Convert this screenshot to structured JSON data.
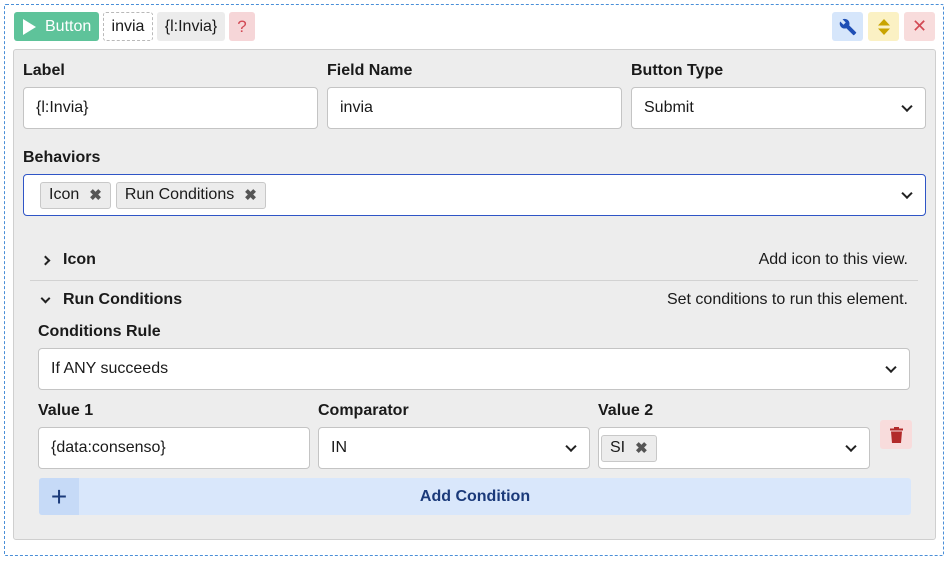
{
  "header": {
    "type_label": "Button",
    "field_name": "invia",
    "label_value": "{l:Invia}",
    "help_label": "?",
    "close_label": "✕"
  },
  "form": {
    "label_title": "Label",
    "label_value": "{l:Invia}",
    "field_name_title": "Field Name",
    "field_name_value": "invia",
    "button_type_title": "Button Type",
    "button_type_value": "Submit",
    "behaviors_title": "Behaviors",
    "behaviors": [
      {
        "label": "Icon",
        "remove": "✖"
      },
      {
        "label": "Run Conditions",
        "remove": "✖"
      }
    ]
  },
  "sections": {
    "icon": {
      "title": "Icon",
      "description": "Add icon to this view."
    },
    "run_conditions": {
      "title": "Run Conditions",
      "description": "Set conditions to run this element."
    }
  },
  "conditions": {
    "rule_title": "Conditions Rule",
    "rule_value": "If ANY succeeds",
    "value1_title": "Value 1",
    "comparator_title": "Comparator",
    "value2_title": "Value 2",
    "rows": [
      {
        "value1": "{data:consenso}",
        "comparator": "IN",
        "value2_tags": [
          {
            "label": "SI",
            "remove": "✖"
          }
        ]
      }
    ],
    "add_label": "Add Condition",
    "add_icon": "+"
  },
  "colors": {
    "type_chip": "#5ec39a",
    "focus_border": "#2f55c6",
    "add_row": "#d9e7fb",
    "delete": "#c0392b"
  }
}
